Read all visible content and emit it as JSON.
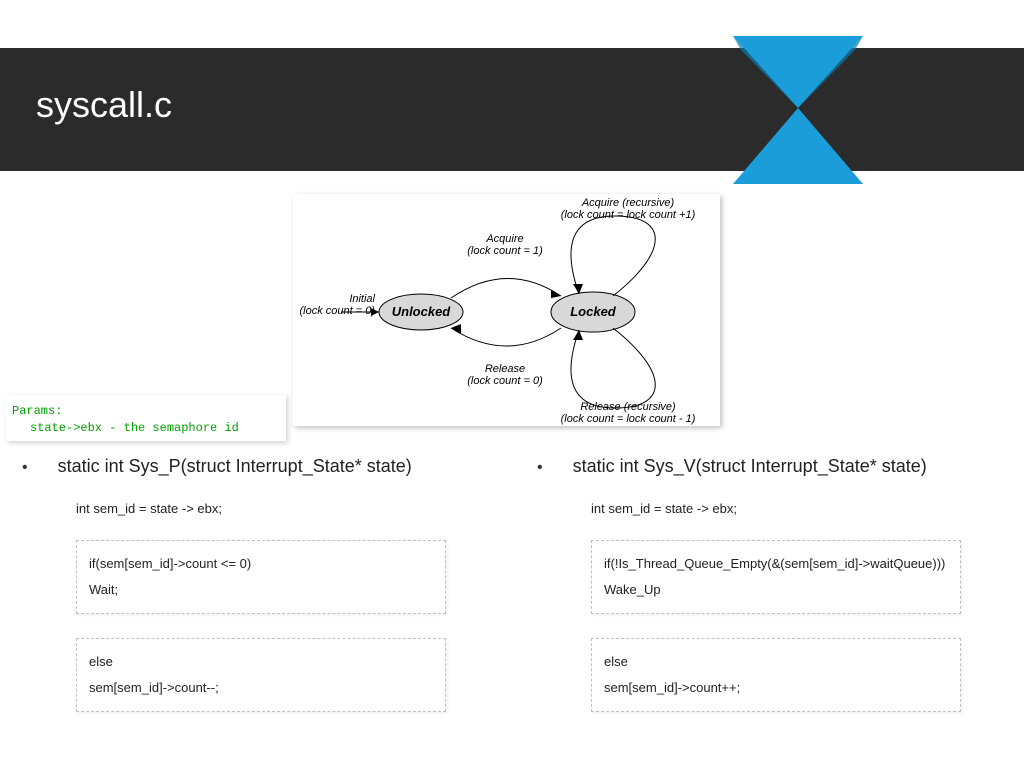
{
  "header": {
    "title": "syscall.c"
  },
  "diagram": {
    "state_unlocked": "Unlocked",
    "state_locked": "Locked",
    "initial_l1": "Initial",
    "initial_l2": "(lock count = 0)",
    "acquire_l1": "Acquire",
    "acquire_l2": "(lock count = 1)",
    "release_l1": "Release",
    "release_l2": "(lock count = 0)",
    "acquire_rec_l1": "Acquire (recursive)",
    "acquire_rec_l2": "(lock count = lock count +1)",
    "release_rec_l1": "Release (recursive)",
    "release_rec_l2": "(lock count = lock count - 1)"
  },
  "params": {
    "line1": "Params:",
    "line2": "state->ebx - the semaphore id"
  },
  "left": {
    "signature": "static int Sys_P(struct Interrupt_State* state)",
    "line1": "int sem_id = state -> ebx;",
    "box1_l1": "if(sem[sem_id]->count <= 0)",
    "box1_l2": "Wait;",
    "box2_l1": "else",
    "box2_l2": "sem[sem_id]->count--;"
  },
  "right": {
    "signature": "static int Sys_V(struct Interrupt_State* state)",
    "line1": "int sem_id = state -> ebx;",
    "box1_l1": "if(!Is_Thread_Queue_Empty(&(sem[sem_id]->waitQueue)))",
    "box1_l2": "Wake_Up",
    "box2_l1": "else",
    "box2_l2": "sem[sem_id]->count++;"
  }
}
